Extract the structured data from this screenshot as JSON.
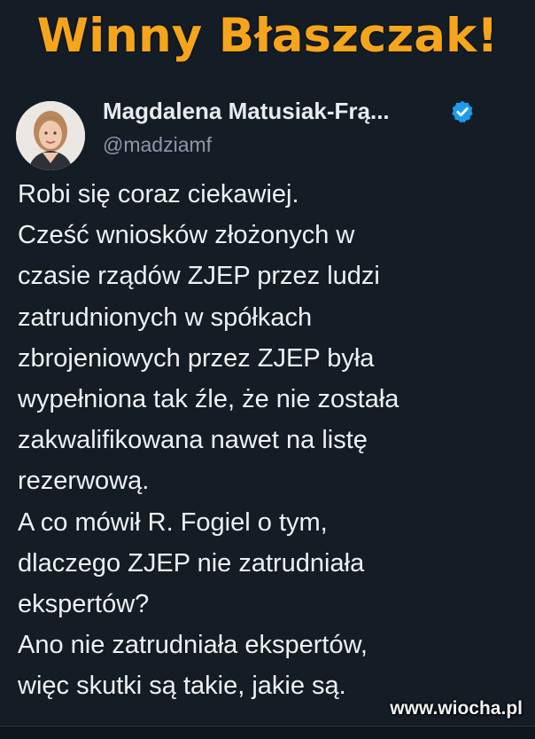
{
  "headline": "Winny Błaszczak!",
  "tweet": {
    "author_name": "Magdalena Matusiak-Frą...",
    "author_handle": "@madziamf",
    "verified_icon": "verified-badge-icon",
    "avatar": "avatar-photo",
    "lines": [
      "Robi się coraz ciekawiej.",
      "Cześć wniosków złożonych w",
      "czasie rządów ZJEP przez ludzi",
      "zatrudnionych w spółkach",
      "zbrojeniowych przez ZJEP była",
      "wypełniona tak źle, że nie została",
      "zakwalifikowana nawet na listę",
      "rezerwową.",
      "A co mówił R. Fogiel o tym,",
      "dlaczego ZJEP nie zatrudniała",
      "ekspertów?",
      "Ano nie zatrudniała ekspertów,",
      "więc skutki są takie, jakie są."
    ]
  },
  "watermark": "www.wiocha.pl",
  "colors": {
    "background": "#141c26",
    "headline": "#f5a51b",
    "verified": "#1d9bf0",
    "handle": "#8a98a8"
  }
}
